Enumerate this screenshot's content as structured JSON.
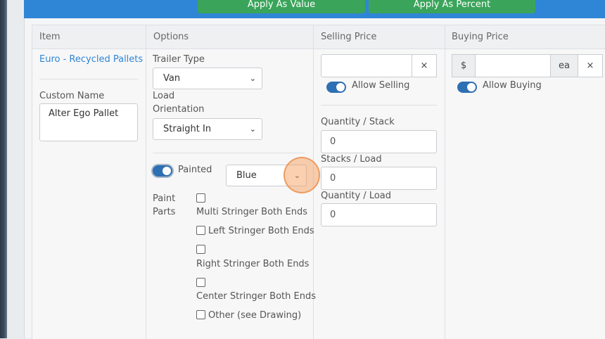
{
  "toolbar": {
    "apply_value_label": "Apply As Value",
    "apply_percent_label": "Apply As Percent"
  },
  "columns": {
    "item": "Item",
    "options": "Options",
    "selling": "Selling Price",
    "buying": "Buying Price"
  },
  "item": {
    "name": "Euro - Recycled Pallets",
    "custom_name_label": "Custom Name",
    "custom_name_value": "Alter Ego Pallet"
  },
  "options": {
    "trailer_type_label": "Trailer Type",
    "trailer_type_value": "Van",
    "load_orientation_label_1": "Load",
    "load_orientation_label_2": "Orientation",
    "load_orientation_value": "Straight In",
    "painted_label": "Painted",
    "painted_on": true,
    "color_value": "Blue",
    "paint_parts_label_1": "Paint",
    "paint_parts_label_2": "Parts",
    "paint_parts": [
      {
        "label": "Multi Stringer Both Ends",
        "checked": false
      },
      {
        "label": "Left Stringer Both Ends",
        "checked": false
      },
      {
        "label": "Right Stringer Both Ends",
        "checked": false
      },
      {
        "label": "Center Stringer Both Ends",
        "checked": false
      },
      {
        "label": "Other (see Drawing)",
        "checked": false
      }
    ]
  },
  "selling": {
    "price_value": "",
    "clear_symbol": "×",
    "allow_label": "Allow Selling",
    "allow_on": true,
    "quantity_stack_label": "Quantity / Stack",
    "quantity_stack_value": "0",
    "stacks_load_label": "Stacks / Load",
    "stacks_load_value": "0",
    "quantity_load_label": "Quantity / Load",
    "quantity_load_value": "0"
  },
  "buying": {
    "currency_symbol": "$",
    "price_value": "",
    "unit": "ea",
    "clear_symbol": "×",
    "allow_label": "Allow Buying",
    "allow_on": true
  },
  "colors": {
    "accent": "#2f86d6",
    "green": "#3aa45a",
    "toggle": "#2f6fb3"
  },
  "icons": {
    "chevron": "chevron-down-icon",
    "clear": "close-icon"
  }
}
